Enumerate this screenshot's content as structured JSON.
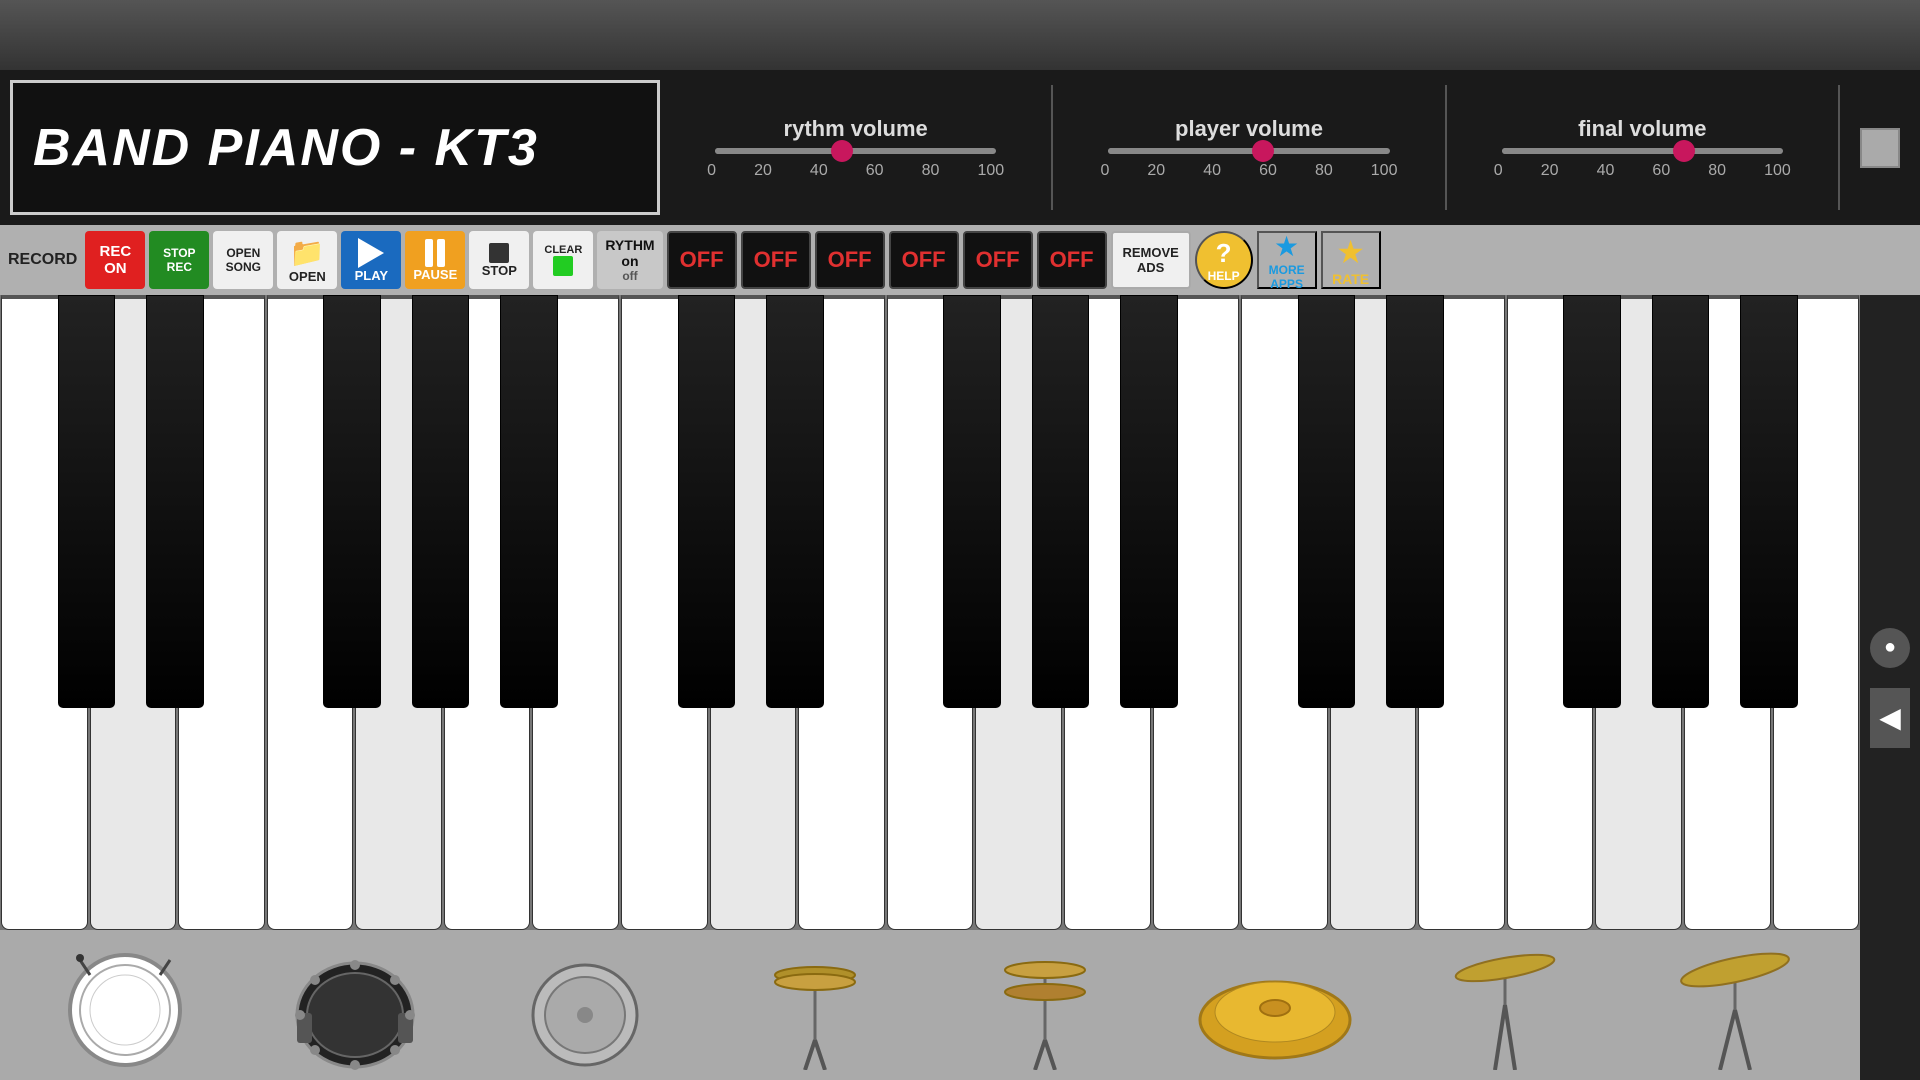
{
  "app": {
    "title": "BAND PIANO - KT3"
  },
  "topBar": {
    "height": 70
  },
  "volumes": {
    "rythm": {
      "label": "rythm volume",
      "value": 45,
      "thumbPercent": 45,
      "marks": [
        "0",
        "20",
        "40",
        "60",
        "80",
        "100"
      ]
    },
    "player": {
      "label": "player volume",
      "value": 55,
      "thumbPercent": 55,
      "marks": [
        "0",
        "20",
        "40",
        "60",
        "80",
        "100"
      ]
    },
    "final": {
      "label": "final volume",
      "value": 65,
      "thumbPercent": 65,
      "marks": [
        "0",
        "20",
        "40",
        "60",
        "80",
        "100"
      ]
    }
  },
  "toolbar": {
    "record_label": "RECORD",
    "rec_on_label": "REC\nON",
    "stop_rec_label": "STOP\nREC",
    "open_song_label": "OPEN\nSONG",
    "open_label": "OPEN",
    "play_label": "PLAY",
    "pause_label": "PAUSE",
    "stop_label": "STOP",
    "clear_label": "CLEAR",
    "rythm_on_label": "RYTHM",
    "rythm_on": "on",
    "rythm_off": "off",
    "off_buttons": [
      "OFF",
      "OFF",
      "OFF",
      "OFF",
      "OFF",
      "OFF"
    ],
    "remove_ads_line1": "REMOVE",
    "remove_ads_line2": "ADS",
    "help_label": "HELP",
    "more_apps_label": "MORE\nAPPS",
    "rate_label": "RATE"
  },
  "drums": [
    {
      "name": "snare-drum",
      "emoji": "🥁",
      "label": ""
    },
    {
      "name": "bass-drum-2",
      "emoji": "🥁",
      "label": ""
    },
    {
      "name": "bass-drum",
      "emoji": "🥁",
      "label": ""
    },
    {
      "name": "hi-hat-closed",
      "emoji": "🥁",
      "label": ""
    },
    {
      "name": "hi-hat-open",
      "emoji": "🥁",
      "label": ""
    },
    {
      "name": "cymbal",
      "emoji": "🥁",
      "label": ""
    },
    {
      "name": "crash-cymbal",
      "emoji": "🥁",
      "label": ""
    },
    {
      "name": "ride-cymbal",
      "emoji": "🥁",
      "label": ""
    }
  ],
  "piano": {
    "white_key_count": 21,
    "black_key_positions": [
      0.05,
      0.09,
      0.14,
      0.18,
      0.23,
      0.28,
      0.32,
      0.37,
      0.41,
      0.46,
      0.51,
      0.55,
      0.6,
      0.64,
      0.69,
      0.74,
      0.78,
      0.83,
      0.87,
      0.92
    ]
  }
}
